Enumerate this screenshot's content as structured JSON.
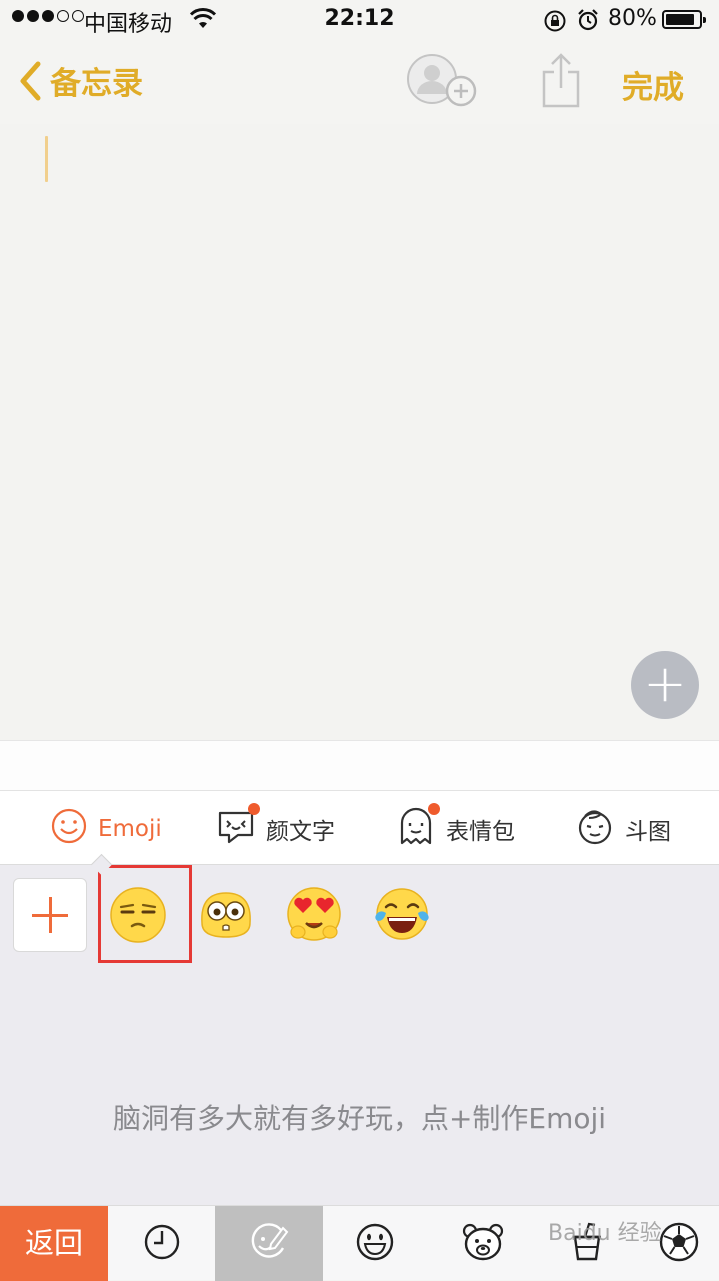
{
  "status_bar": {
    "carrier": "中国移动",
    "time": "22:12",
    "battery": "80%",
    "icons": [
      "signal-dots",
      "wifi-icon",
      "rotation-lock-icon",
      "alarm-icon",
      "battery-icon"
    ]
  },
  "nav": {
    "back_label": "备忘录",
    "done_label": "完成",
    "accent_color": "#e0ac28",
    "icons": [
      "chevron-left-icon",
      "add-person-icon",
      "share-icon"
    ]
  },
  "note": {
    "float_button": "+"
  },
  "keyboard": {
    "tabs": [
      {
        "label": "Emoji",
        "icon": "smiley-icon",
        "active": true
      },
      {
        "label": "颜文字",
        "icon": "kaomoji-icon",
        "badge": true
      },
      {
        "label": "表情包",
        "icon": "ghost-icon",
        "badge": true
      },
      {
        "label": "斗图",
        "icon": "face-sticker-icon"
      }
    ],
    "accent_color": "#ef6b3a",
    "emojis": [
      "😒",
      "😳",
      "😍",
      "😂"
    ],
    "hint": "脑洞有多大就有多好玩，点+制作Emoji",
    "bottom": {
      "return_label": "返回",
      "icons": [
        "clock-icon",
        "emoji-maker-icon",
        "smile-icon",
        "bear-icon",
        "objects-icon",
        "soccer-icon"
      ]
    },
    "watermark": "Baidu 经验"
  }
}
